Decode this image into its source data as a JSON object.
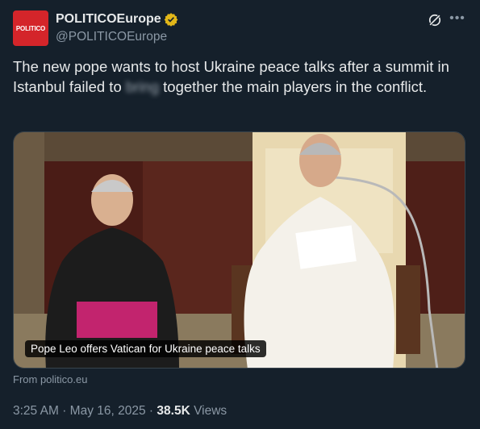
{
  "author": {
    "avatar_text": "POLITICO",
    "display_name": "POLITICOEurope",
    "handle": "@POLITICOEurope",
    "verified_color": "#e2b719"
  },
  "tweet": {
    "text_before": "The new pope wants to host Ukraine peace talks after a summit in Istanbul failed to ",
    "text_blurred": "bring",
    "text_after": " together the main players in the conflict."
  },
  "media": {
    "caption": "Pope Leo offers Vatican for Ukraine peace talks",
    "source": "From politico.eu"
  },
  "meta": {
    "time": "3:25 AM",
    "date": "May 16, 2025",
    "views_count": "38.5K",
    "views_label": "Views",
    "separator": "·"
  },
  "icons": [
    "verified-badge-icon",
    "grok-icon",
    "more-icon"
  ],
  "colors": {
    "background": "#15202b",
    "text": "#e7e9ea",
    "muted": "#8b98a5",
    "brand": "#d4252a"
  }
}
